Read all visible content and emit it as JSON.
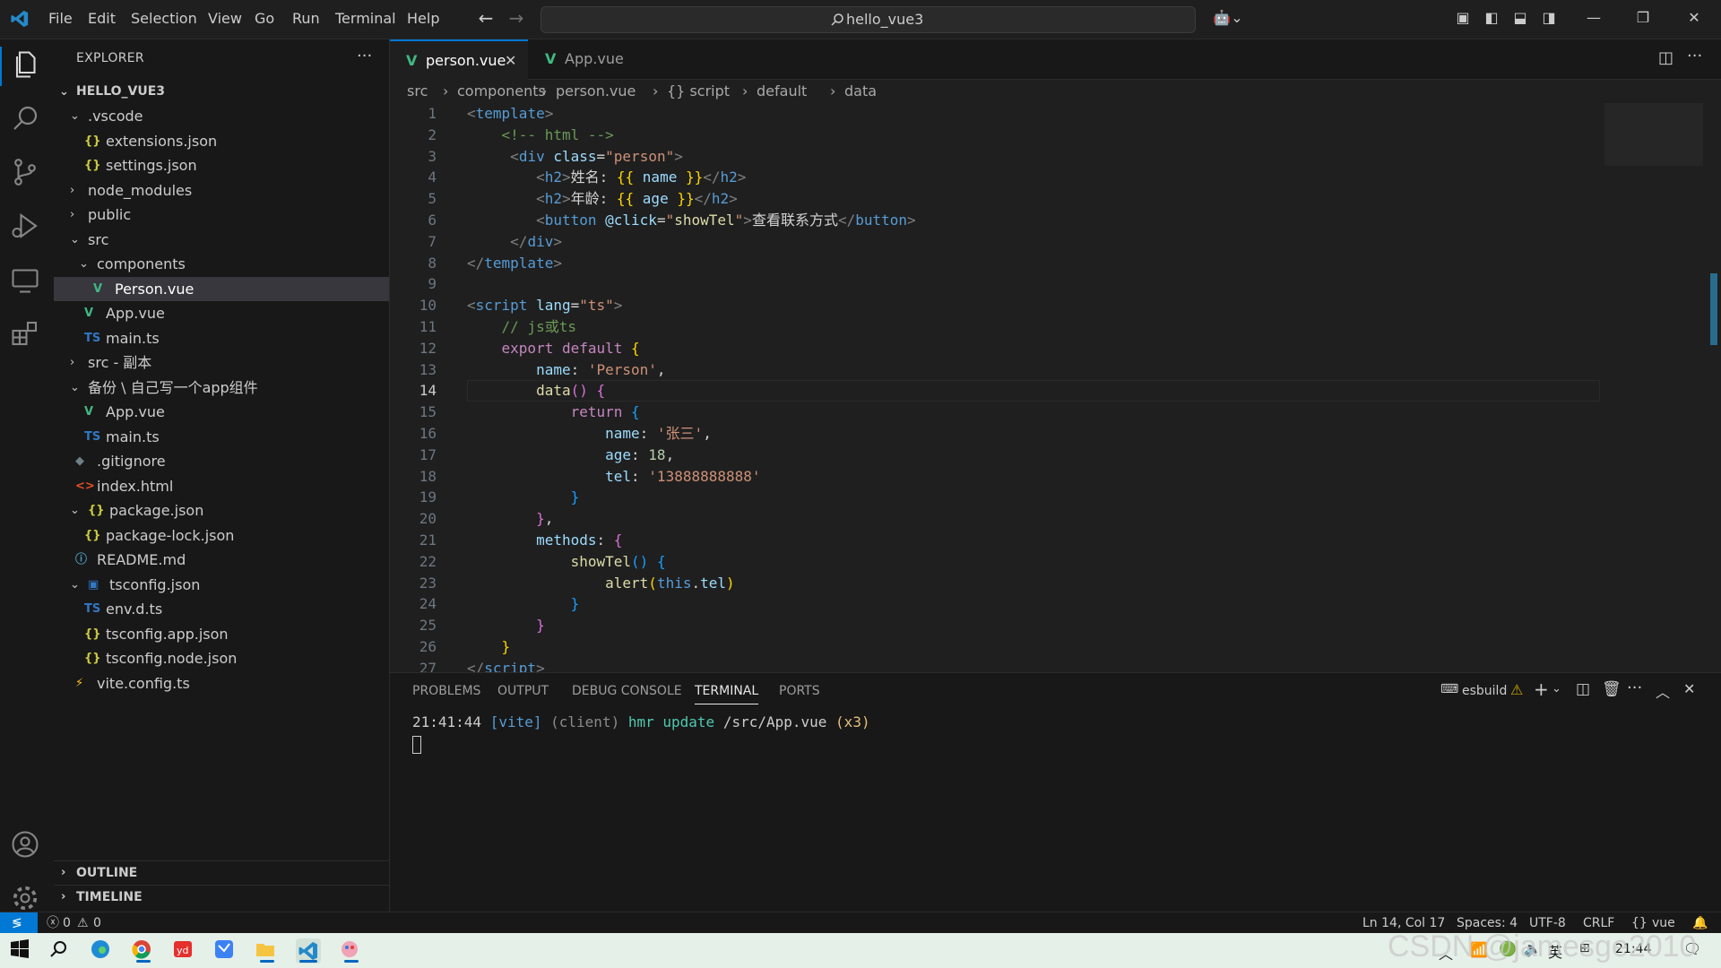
{
  "titlebar": {
    "menu": [
      "File",
      "Edit",
      "Selection",
      "View",
      "Go",
      "Run",
      "Terminal",
      "Help"
    ],
    "search": "hello_vue3"
  },
  "explorer": {
    "title": "EXPLORER",
    "root": "HELLO_VUE3",
    "items": [
      {
        "label": ".vscode",
        "icon": "chevron-down",
        "indent": 1,
        "type": "folder-open"
      },
      {
        "label": "extensions.json",
        "icon": "json",
        "indent": 2,
        "type": "file"
      },
      {
        "label": "settings.json",
        "icon": "json",
        "indent": 2,
        "type": "file"
      },
      {
        "label": "node_modules",
        "icon": "chevron-right",
        "indent": 1,
        "type": "folder"
      },
      {
        "label": "public",
        "icon": "chevron-right",
        "indent": 1,
        "type": "folder"
      },
      {
        "label": "src",
        "icon": "chevron-down",
        "indent": 1,
        "type": "folder-open"
      },
      {
        "label": "components",
        "icon": "chevron-down",
        "indent": 2,
        "type": "folder-open"
      },
      {
        "label": "Person.vue",
        "icon": "vue",
        "indent": 3,
        "type": "file",
        "selected": true
      },
      {
        "label": "App.vue",
        "icon": "vue",
        "indent": 2,
        "type": "file"
      },
      {
        "label": "main.ts",
        "icon": "ts",
        "indent": 2,
        "type": "file"
      },
      {
        "label": "src - 副本",
        "icon": "chevron-right",
        "indent": 1,
        "type": "folder"
      },
      {
        "label": "备份 \\ 自己写一个app组件",
        "icon": "chevron-down",
        "indent": 1,
        "type": "folder-open"
      },
      {
        "label": "App.vue",
        "icon": "vue",
        "indent": 2,
        "type": "file"
      },
      {
        "label": "main.ts",
        "icon": "ts",
        "indent": 2,
        "type": "file"
      },
      {
        "label": ".gitignore",
        "icon": "git",
        "indent": 1,
        "type": "file"
      },
      {
        "label": "index.html",
        "icon": "html",
        "indent": 1,
        "type": "file"
      },
      {
        "label": "package.json",
        "icon": "chevron-down",
        "indent": 1,
        "type": "folder-open",
        "fileicon": "json"
      },
      {
        "label": "package-lock.json",
        "icon": "json",
        "indent": 2,
        "type": "file"
      },
      {
        "label": "README.md",
        "icon": "info",
        "indent": 1,
        "type": "file"
      },
      {
        "label": "tsconfig.json",
        "icon": "chevron-down",
        "indent": 1,
        "type": "folder-open",
        "fileicon": "tsconfig"
      },
      {
        "label": "env.d.ts",
        "icon": "ts",
        "indent": 2,
        "type": "file"
      },
      {
        "label": "tsconfig.app.json",
        "icon": "json",
        "indent": 2,
        "type": "file"
      },
      {
        "label": "tsconfig.node.json",
        "icon": "json",
        "indent": 2,
        "type": "file"
      },
      {
        "label": "vite.config.ts",
        "icon": "vite",
        "indent": 1,
        "type": "file"
      }
    ],
    "outline": "OUTLINE",
    "timeline": "TIMELINE"
  },
  "tabs": [
    {
      "label": "person.vue",
      "active": true
    },
    {
      "label": "App.vue",
      "active": false
    }
  ],
  "breadcrumb": [
    "src",
    "components",
    "person.vue",
    "{} script",
    "default",
    "data"
  ],
  "code": [
    [
      [
        "c-tag",
        "<"
      ],
      [
        "c-tn",
        "template"
      ],
      [
        "c-tag",
        ">"
      ]
    ],
    [
      [
        "c-plain",
        "    "
      ],
      [
        "c-cm",
        "<!-- html -->"
      ]
    ],
    [
      [
        "c-plain",
        "     "
      ],
      [
        "c-tag",
        "<"
      ],
      [
        "c-tn",
        "div "
      ],
      [
        "c-attr",
        "class"
      ],
      [
        "c-plain",
        "="
      ],
      [
        "c-str",
        "\"person\""
      ],
      [
        "c-tag",
        ">"
      ]
    ],
    [
      [
        "c-plain",
        "        "
      ],
      [
        "c-tag",
        "<"
      ],
      [
        "c-tn",
        "h2"
      ],
      [
        "c-tag",
        ">"
      ],
      [
        "c-plain",
        "姓名: "
      ],
      [
        "c-br1",
        "{{ "
      ],
      [
        "c-attr",
        "name"
      ],
      [
        "c-br1",
        " }}"
      ],
      [
        "c-tag",
        "</"
      ],
      [
        "c-tn",
        "h2"
      ],
      [
        "c-tag",
        ">"
      ]
    ],
    [
      [
        "c-plain",
        "        "
      ],
      [
        "c-tag",
        "<"
      ],
      [
        "c-tn",
        "h2"
      ],
      [
        "c-tag",
        ">"
      ],
      [
        "c-plain",
        "年龄: "
      ],
      [
        "c-br1",
        "{{ "
      ],
      [
        "c-attr",
        "age"
      ],
      [
        "c-br1",
        " }}"
      ],
      [
        "c-tag",
        "</"
      ],
      [
        "c-tn",
        "h2"
      ],
      [
        "c-tag",
        ">"
      ]
    ],
    [
      [
        "c-plain",
        "        "
      ],
      [
        "c-tag",
        "<"
      ],
      [
        "c-tn",
        "button "
      ],
      [
        "c-attr",
        "@click"
      ],
      [
        "c-plain",
        "="
      ],
      [
        "c-str",
        "\""
      ],
      [
        "c-fn",
        "showTel"
      ],
      [
        "c-str",
        "\""
      ],
      [
        "c-tag",
        ">"
      ],
      [
        "c-plain",
        "查看联系方式"
      ],
      [
        "c-tag",
        "</"
      ],
      [
        "c-tn",
        "button"
      ],
      [
        "c-tag",
        ">"
      ]
    ],
    [
      [
        "c-plain",
        "     "
      ],
      [
        "c-tag",
        "</"
      ],
      [
        "c-tn",
        "div"
      ],
      [
        "c-tag",
        ">"
      ]
    ],
    [
      [
        "c-tag",
        "</"
      ],
      [
        "c-tn",
        "template"
      ],
      [
        "c-tag",
        ">"
      ]
    ],
    [
      [
        "c-plain",
        ""
      ]
    ],
    [
      [
        "c-tag",
        "<"
      ],
      [
        "c-tn",
        "script "
      ],
      [
        "c-attr",
        "lang"
      ],
      [
        "c-plain",
        "="
      ],
      [
        "c-str",
        "\"ts\""
      ],
      [
        "c-tag",
        ">"
      ]
    ],
    [
      [
        "c-plain",
        "    "
      ],
      [
        "c-cm",
        "// js或ts"
      ]
    ],
    [
      [
        "c-plain",
        "    "
      ],
      [
        "c-kw",
        "export default "
      ],
      [
        "c-br1",
        "{"
      ]
    ],
    [
      [
        "c-plain",
        "        "
      ],
      [
        "c-attr",
        "name"
      ],
      [
        "c-plain",
        ": "
      ],
      [
        "c-str",
        "'Person'"
      ],
      [
        "c-plain",
        ","
      ]
    ],
    [
      [
        "c-plain",
        "        "
      ],
      [
        "c-fn",
        "data"
      ],
      [
        "c-br2",
        "()"
      ],
      [
        "c-plain",
        " "
      ],
      [
        "c-br2",
        "{"
      ]
    ],
    [
      [
        "c-plain",
        "            "
      ],
      [
        "c-kw",
        "return "
      ],
      [
        "c-br3",
        "{"
      ]
    ],
    [
      [
        "c-plain",
        "                "
      ],
      [
        "c-attr",
        "name"
      ],
      [
        "c-plain",
        ": "
      ],
      [
        "c-str",
        "'张三'"
      ],
      [
        "c-plain",
        ","
      ]
    ],
    [
      [
        "c-plain",
        "                "
      ],
      [
        "c-attr",
        "age"
      ],
      [
        "c-plain",
        ": "
      ],
      [
        "c-num",
        "18"
      ],
      [
        "c-plain",
        ","
      ]
    ],
    [
      [
        "c-plain",
        "                "
      ],
      [
        "c-attr",
        "tel"
      ],
      [
        "c-plain",
        ": "
      ],
      [
        "c-str",
        "'13888888888'"
      ]
    ],
    [
      [
        "c-plain",
        "            "
      ],
      [
        "c-br3",
        "}"
      ]
    ],
    [
      [
        "c-plain",
        "        "
      ],
      [
        "c-br2",
        "}"
      ],
      [
        "c-plain",
        ","
      ]
    ],
    [
      [
        "c-plain",
        "        "
      ],
      [
        "c-attr",
        "methods"
      ],
      [
        "c-plain",
        ": "
      ],
      [
        "c-br2",
        "{"
      ]
    ],
    [
      [
        "c-plain",
        "            "
      ],
      [
        "c-fn",
        "showTel"
      ],
      [
        "c-br3",
        "()"
      ],
      [
        "c-plain",
        " "
      ],
      [
        "c-br3",
        "{"
      ]
    ],
    [
      [
        "c-plain",
        "                "
      ],
      [
        "c-fn",
        "alert"
      ],
      [
        "c-br1",
        "("
      ],
      [
        "c-this",
        "this"
      ],
      [
        "c-plain",
        "."
      ],
      [
        "c-attr",
        "tel"
      ],
      [
        "c-br1",
        ")"
      ]
    ],
    [
      [
        "c-plain",
        "            "
      ],
      [
        "c-br3",
        "}"
      ]
    ],
    [
      [
        "c-plain",
        "        "
      ],
      [
        "c-br2",
        "}"
      ]
    ],
    [
      [
        "c-plain",
        "    "
      ],
      [
        "c-br1",
        "}"
      ]
    ],
    [
      [
        "c-tag",
        "</"
      ],
      [
        "c-tn",
        "script"
      ],
      [
        "c-tag",
        ">"
      ]
    ]
  ],
  "current_line": 14,
  "panel": {
    "tabs": [
      "PROBLEMS",
      "OUTPUT",
      "DEBUG CONSOLE",
      "TERMINAL",
      "PORTS"
    ],
    "active": "TERMINAL",
    "terminal_name": "esbuild",
    "terminal": [
      [
        "#cccccc",
        "21:41:44 "
      ],
      [
        "#569cd6",
        "[vite] "
      ],
      [
        "#8a8a8a",
        "(client) "
      ],
      [
        "#4ec9b0",
        "hmr update "
      ],
      [
        "#cccccc",
        "/src/App.vue "
      ],
      [
        "#e5c07b",
        "(x3)"
      ]
    ]
  },
  "status": {
    "errors": "0",
    "warnings": "0",
    "position": "Ln 14, Col 17",
    "spaces": "Spaces: 4",
    "encoding": "UTF-8",
    "eol": "CRLF",
    "language": "vue"
  },
  "taskbar": {
    "ime": "英",
    "time": "21:44",
    "watermark": "CSDN @jamesge2010"
  }
}
